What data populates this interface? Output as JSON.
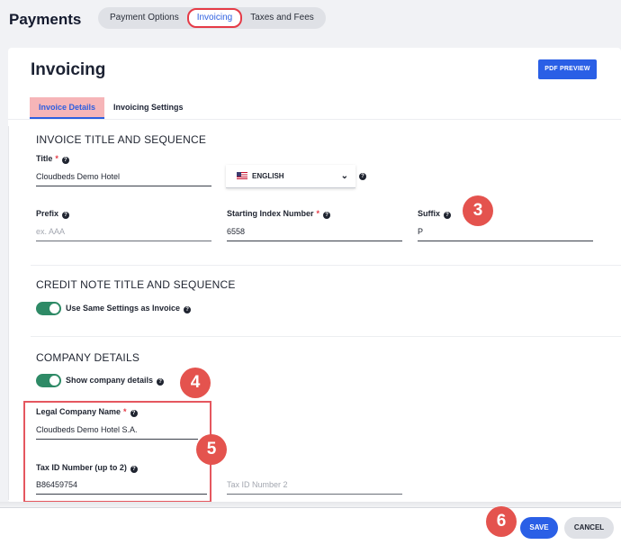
{
  "header": {
    "title": "Payments",
    "tabs": [
      "Payment Options",
      "Invoicing",
      "Taxes and Fees"
    ]
  },
  "card": {
    "title": "Invoicing",
    "pdf_preview_label": "PDF PREVIEW",
    "tabs": [
      "Invoice Details",
      "Invoicing Settings"
    ]
  },
  "invoice_section": {
    "heading": "INVOICE TITLE AND SEQUENCE",
    "title_label": "Title",
    "title_value": "Cloudbeds Demo Hotel",
    "language_value": "ENGLISH",
    "prefix_label": "Prefix",
    "prefix_placeholder": "ex. AAA",
    "starting_index_label": "Starting Index Number",
    "starting_index_value": "6558",
    "suffix_label": "Suffix",
    "suffix_value": "P"
  },
  "credit_note_section": {
    "heading": "CREDIT NOTE TITLE AND SEQUENCE",
    "same_settings_label": "Use Same Settings as Invoice",
    "same_settings_on": true
  },
  "company_section": {
    "heading": "COMPANY DETAILS",
    "show_details_label": "Show company details",
    "show_details_on": true,
    "legal_name_label": "Legal Company Name",
    "legal_name_value": "Cloudbeds Demo Hotel S.A.",
    "tax_id_label": "Tax ID Number (up to 2)",
    "tax_id_1_value": "B86459754",
    "tax_id_2_placeholder": "Tax ID Number 2"
  },
  "markers": [
    "3",
    "4",
    "5",
    "6"
  ],
  "footer": {
    "save_label": "SAVE",
    "cancel_label": "CANCEL"
  },
  "colors": {
    "primary": "#2a5fe6",
    "toggle_on": "#2e8a66",
    "marker": "#e4534e",
    "required": "#e53b47"
  }
}
